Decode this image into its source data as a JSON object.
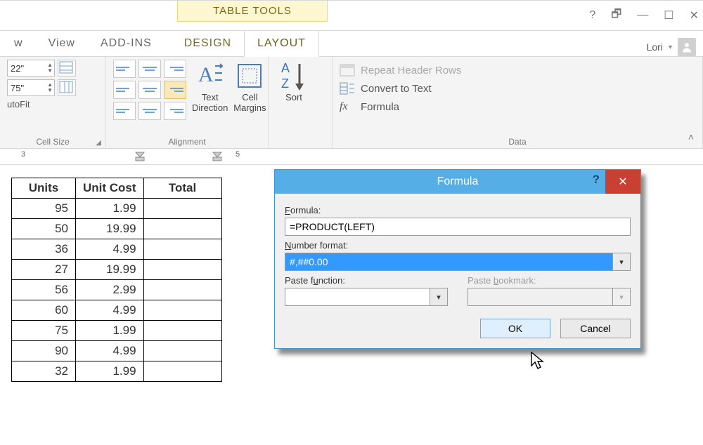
{
  "chrome": {
    "table_tools": "TABLE TOOLS",
    "user_name": "Lori",
    "help_glyph": "?",
    "restore_glyph": "🗗",
    "min_glyph": "—",
    "close_glyph": "✕"
  },
  "tabs": {
    "view_small": "w",
    "view": "View",
    "addins": "ADD-INS",
    "design": "DESIGN",
    "layout": "LAYOUT"
  },
  "ribbon": {
    "cell_size": {
      "height": "22\"",
      "width": "75\"",
      "autofit": "utoFit",
      "group": "Cell Size"
    },
    "alignment": {
      "text_direction": "Text Direction",
      "cell_margins": "Cell Margins",
      "group": "Alignment"
    },
    "sort": "Sort",
    "data": {
      "repeat": "Repeat Header Rows",
      "convert": "Convert to Text",
      "formula": "Formula",
      "group": "Data"
    }
  },
  "ruler": {
    "n3": "3",
    "n5": "5"
  },
  "table": {
    "headers": [
      "Units",
      "Unit Cost",
      "Total"
    ],
    "rows": [
      {
        "units": "95",
        "cost": "1.99",
        "total": ""
      },
      {
        "units": "50",
        "cost": "19.99",
        "total": ""
      },
      {
        "units": "36",
        "cost": "4.99",
        "total": ""
      },
      {
        "units": "27",
        "cost": "19.99",
        "total": ""
      },
      {
        "units": "56",
        "cost": "2.99",
        "total": ""
      },
      {
        "units": "60",
        "cost": "4.99",
        "total": ""
      },
      {
        "units": "75",
        "cost": "1.99",
        "total": ""
      },
      {
        "units": "90",
        "cost": "4.99",
        "total": ""
      },
      {
        "units": "32",
        "cost": "1.99",
        "total": ""
      }
    ]
  },
  "dialog": {
    "title": "Formula",
    "formula_label": "Formula:",
    "formula_value": "=PRODUCT(LEFT)",
    "numfmt_label": "Number format:",
    "numfmt_value": "#,##0.00",
    "pastefn_label": "Paste function:",
    "pastefn_value": "",
    "pastebk_label": "Paste bookmark:",
    "pastebk_value": "",
    "ok": "OK",
    "cancel": "Cancel"
  }
}
